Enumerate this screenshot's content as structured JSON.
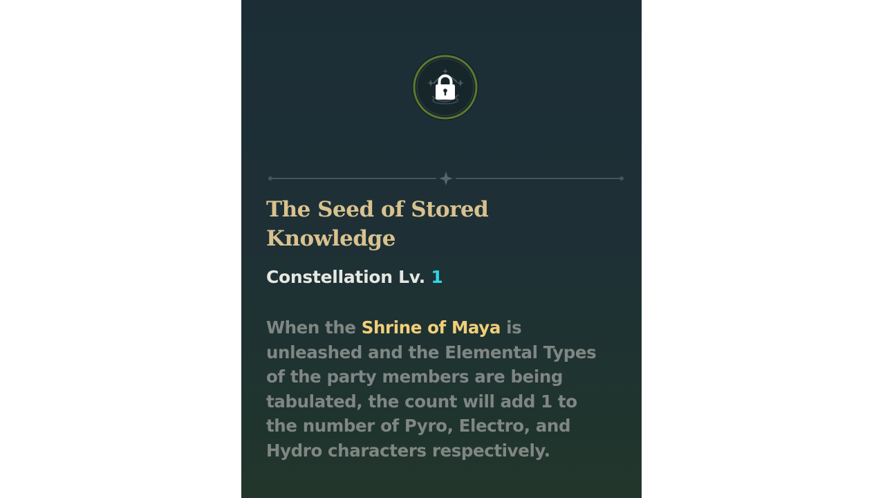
{
  "constellation": {
    "status_icon": "lock-icon",
    "title": "The Seed of Stored Knowledge",
    "level_label": "Constellation Lv.",
    "level_value": "1",
    "description": {
      "part1": "When the ",
      "highlight": "Shrine of Maya",
      "part2": " is unleashed and the Elemental Types of the party members are being tabulated, the count will add 1 to the number of Pyro, Electro, and Hydro characters respectively."
    }
  },
  "colors": {
    "panel_background": "#1e3036",
    "title": "#d9c28f",
    "level_text": "#e7e7e2",
    "level_number": "#2fd6e2",
    "description_text": "#7f8683",
    "highlight": "#f1cf7a",
    "badge_ring": "#5b7a2e"
  }
}
